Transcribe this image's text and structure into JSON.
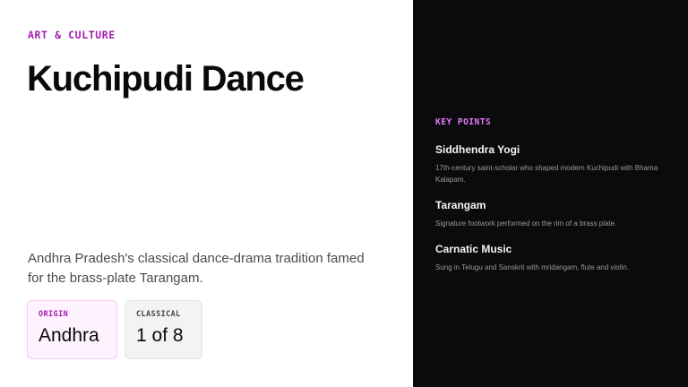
{
  "left": {
    "eyebrow": "ART & CULTURE",
    "title": "Kuchipudi Dance",
    "description": "Andhra Pradesh's classical dance-drama tradition famed for the brass-plate Tarangam.",
    "stats": [
      {
        "label": "ORIGIN",
        "value": "Andhra"
      },
      {
        "label": "CLASSICAL",
        "value": "1 of 8"
      }
    ]
  },
  "right": {
    "section_label": "KEY POINTS",
    "points": [
      {
        "title": "Siddhendra Yogi",
        "text": "17th-century saint-scholar who shaped modern Kuchipudi with Bhama Kalapam."
      },
      {
        "title": "Tarangam",
        "text": "Signature footwork performed on the rim of a brass plate."
      },
      {
        "title": "Carnatic Music",
        "text": "Sung in Telugu and Sanskrit with mridangam, flute and violin."
      }
    ]
  },
  "colors": {
    "accent": "#a21caf",
    "accent_light": "#e879f9",
    "dark_panel": "#0b0b0d"
  }
}
